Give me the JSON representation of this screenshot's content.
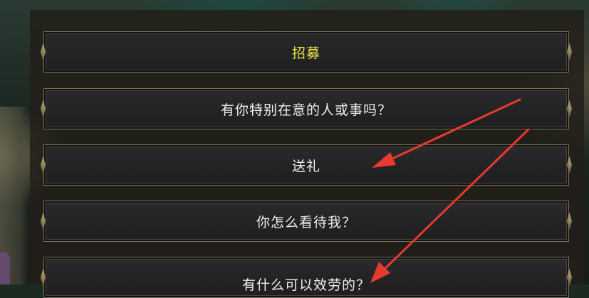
{
  "dialog": {
    "options": [
      {
        "label": "招募",
        "highlighted": true
      },
      {
        "label": "有你特别在意的人或事吗？",
        "highlighted": false
      },
      {
        "label": "送礼",
        "highlighted": false
      },
      {
        "label": "你怎么看待我？",
        "highlighted": false
      },
      {
        "label": "有什么可以效劳的？",
        "highlighted": false
      }
    ]
  },
  "colors": {
    "highlight_text": "#e6e24a",
    "normal_text": "#f1efe9",
    "annotation_arrow": "#e8392f",
    "button_border": "#7d7256"
  },
  "annotations": {
    "arrows": [
      {
        "points_to": "送礼"
      },
      {
        "points_to": "有什么可以效劳的？"
      }
    ]
  }
}
